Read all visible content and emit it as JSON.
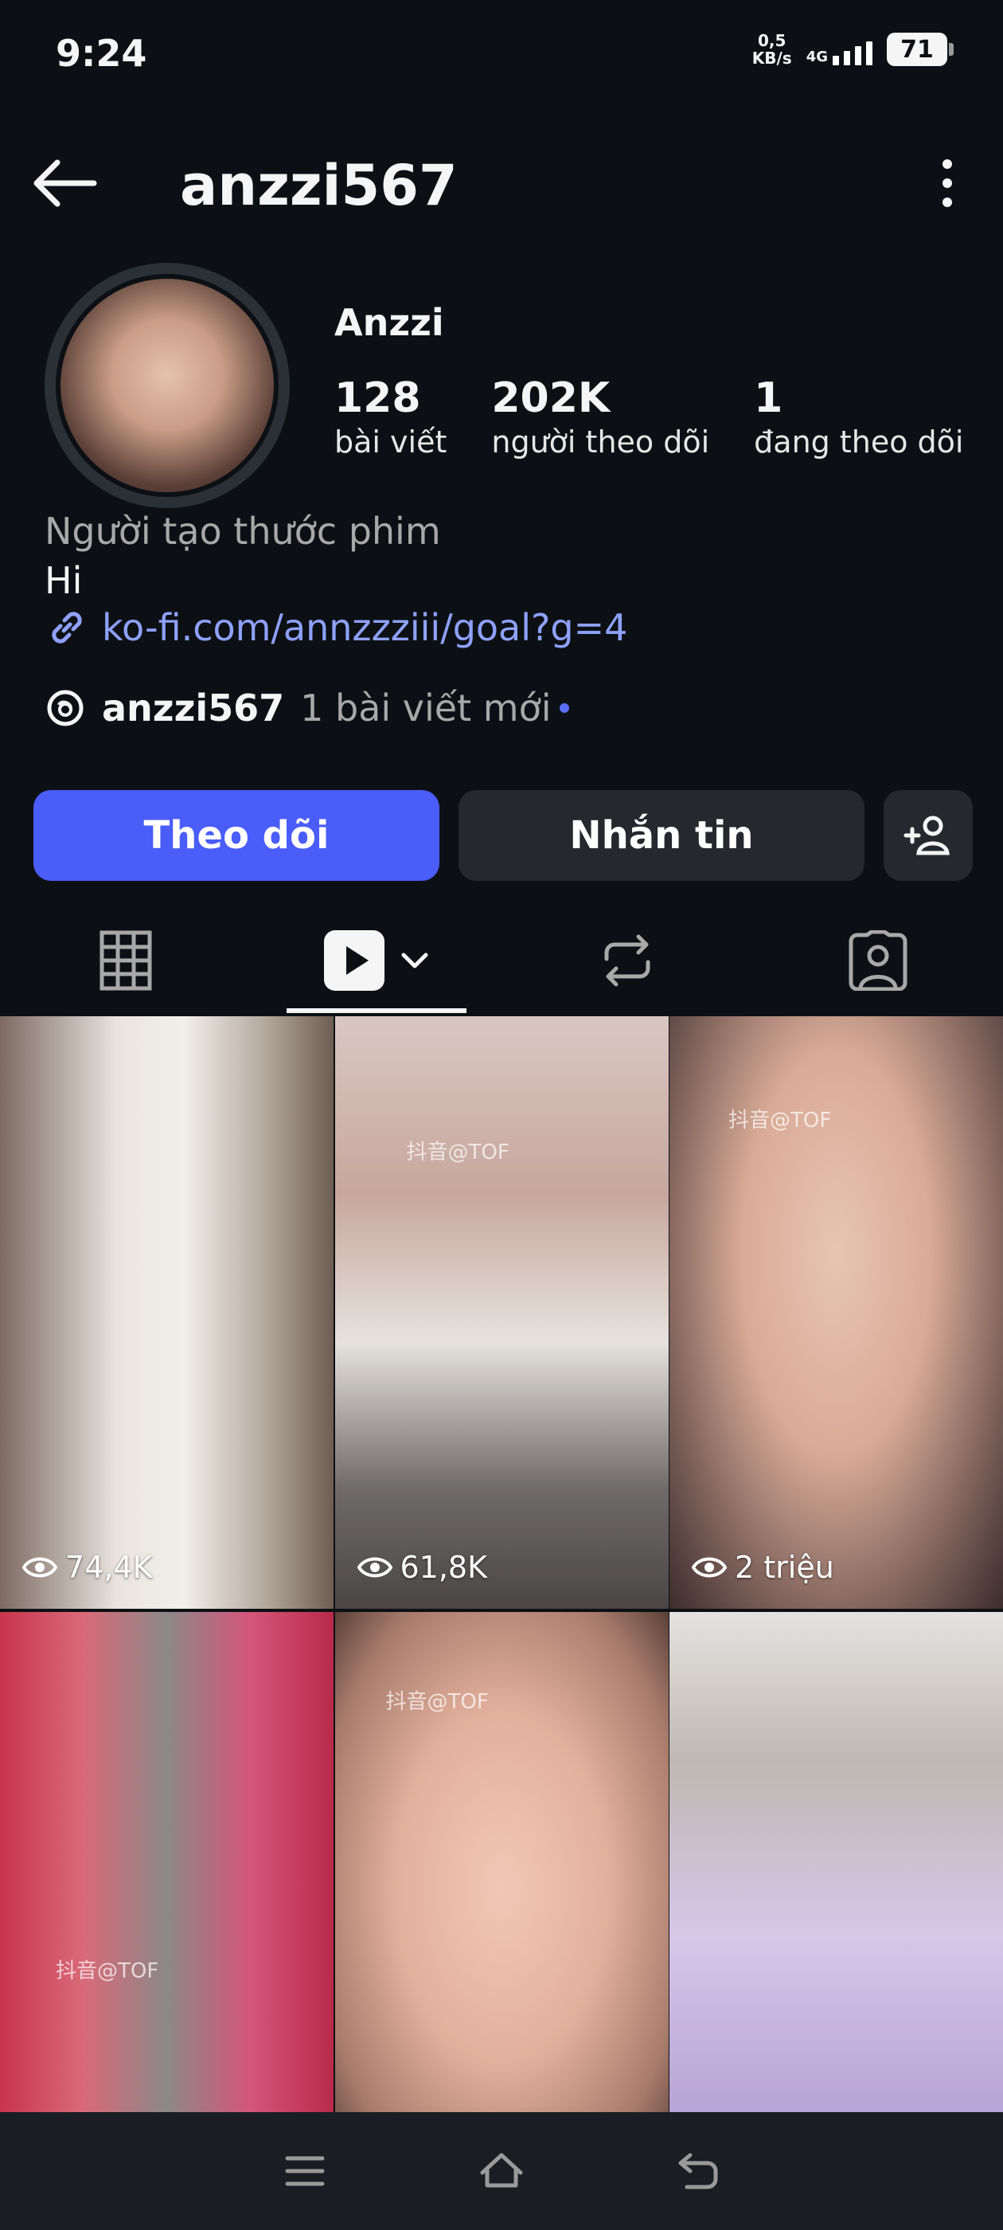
{
  "status": {
    "time": "9:24",
    "net_speed_value": "0,5",
    "net_speed_unit": "KB/s",
    "network": "4G",
    "battery": "71"
  },
  "header": {
    "username": "anzzi567"
  },
  "profile": {
    "display_name": "Anzzi",
    "stats": [
      {
        "value": "128",
        "label": "bài viết"
      },
      {
        "value": "202K",
        "label": "người theo dõi"
      },
      {
        "value": "1",
        "label": "đang theo dõi"
      }
    ],
    "category": "Người tạo thước phim",
    "bio": "Hi",
    "link": "ko-fi.com/annzzziii/goal?g=4",
    "threads_name": "anzzi567",
    "threads_new": "1 bài viết mới"
  },
  "actions": {
    "follow": "Theo dõi",
    "message": "Nhắn tin"
  },
  "tabs": [
    {
      "icon": "grid-icon"
    },
    {
      "icon": "reels-icon",
      "selected": true
    },
    {
      "icon": "reposts-icon"
    },
    {
      "icon": "tagged-icon"
    }
  ],
  "reels": [
    {
      "views": "74,4K"
    },
    {
      "views": "61,8K",
      "watermark": "抖音@TOF"
    },
    {
      "views": "2 triệu",
      "watermark": "抖音@TOF"
    },
    {
      "views": "",
      "watermark": "抖音@TOF"
    },
    {
      "views": "",
      "watermark": "抖音@TOF"
    },
    {
      "views": ""
    }
  ],
  "colors": {
    "background": "#0c1014",
    "accent": "#4a5df9",
    "link": "#8ea2ff",
    "secondary_button": "#25292e"
  }
}
